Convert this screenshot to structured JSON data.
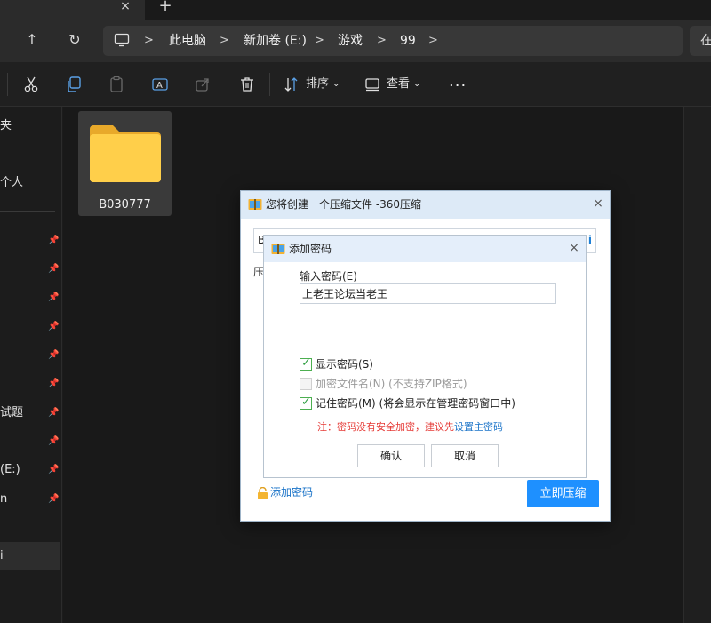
{
  "tabs": {
    "close": "×",
    "new": "+"
  },
  "nav": {
    "up": "↑",
    "refresh": "↻"
  },
  "breadcrumb": {
    "separator": ">",
    "items": [
      "此电脑",
      "新加卷 (E:)",
      "游戏",
      "99"
    ]
  },
  "search": {
    "text": "在"
  },
  "toolbar": {
    "sort_label": "排序",
    "view_label": "查看",
    "dropdown": "⌄",
    "more": "..."
  },
  "sidebar": {
    "items": [
      {
        "label": "夹",
        "pinned": false
      },
      {
        "label": "个人",
        "pinned": false
      },
      {
        "label": "",
        "pinned": true
      },
      {
        "label": "",
        "pinned": true
      },
      {
        "label": "",
        "pinned": true
      },
      {
        "label": "",
        "pinned": true
      },
      {
        "label": "",
        "pinned": true
      },
      {
        "label": "",
        "pinned": true
      },
      {
        "label": "试题",
        "pinned": true
      },
      {
        "label": "",
        "pinned": true
      },
      {
        "label": "(E:)",
        "pinned": true
      },
      {
        "label": "n",
        "pinned": true
      },
      {
        "label": "i",
        "pinned": false
      }
    ],
    "pin_glyph": "📌"
  },
  "content": {
    "folder": {
      "name": "B030777",
      "color": "#ffc83d"
    }
  },
  "compress_dialog": {
    "title": "您将创建一个压缩文件 -360压缩",
    "close": "×",
    "field_prefix": "B",
    "field_suffix": "i",
    "label_partial": "压",
    "add_password_link": "添加密码",
    "start_button": "立即压缩",
    "accent": "#1e90ff"
  },
  "password_dialog": {
    "title": "添加密码",
    "close": "×",
    "input_label": "输入密码(E)",
    "password_value": "上老王论坛当老王",
    "options": [
      {
        "label": "显示密码(S)",
        "checked": true,
        "disabled": false
      },
      {
        "label": "加密文件名(N) (不支持ZIP格式)",
        "checked": false,
        "disabled": true
      },
      {
        "label": "记住密码(M) (将会显示在管理密码窗口中)",
        "checked": true,
        "disabled": false
      }
    ],
    "note_prefix": "注：密码没有安全加密，建议先",
    "note_link": "设置主密码",
    "ok_button": "确认",
    "cancel_button": "取消",
    "note_color": "#e53935"
  }
}
